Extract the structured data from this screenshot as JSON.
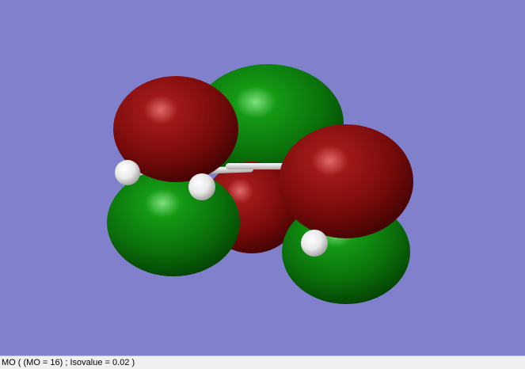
{
  "viewer": {
    "background": "#8080cc",
    "phase_colors": {
      "negative": "#7a0d0d",
      "positive": "#0c7a0c"
    },
    "atom_color": "#ffffff"
  },
  "status_bar": {
    "text": "MO ( (MO = 16) ; Isovalue = 0.02 )"
  }
}
